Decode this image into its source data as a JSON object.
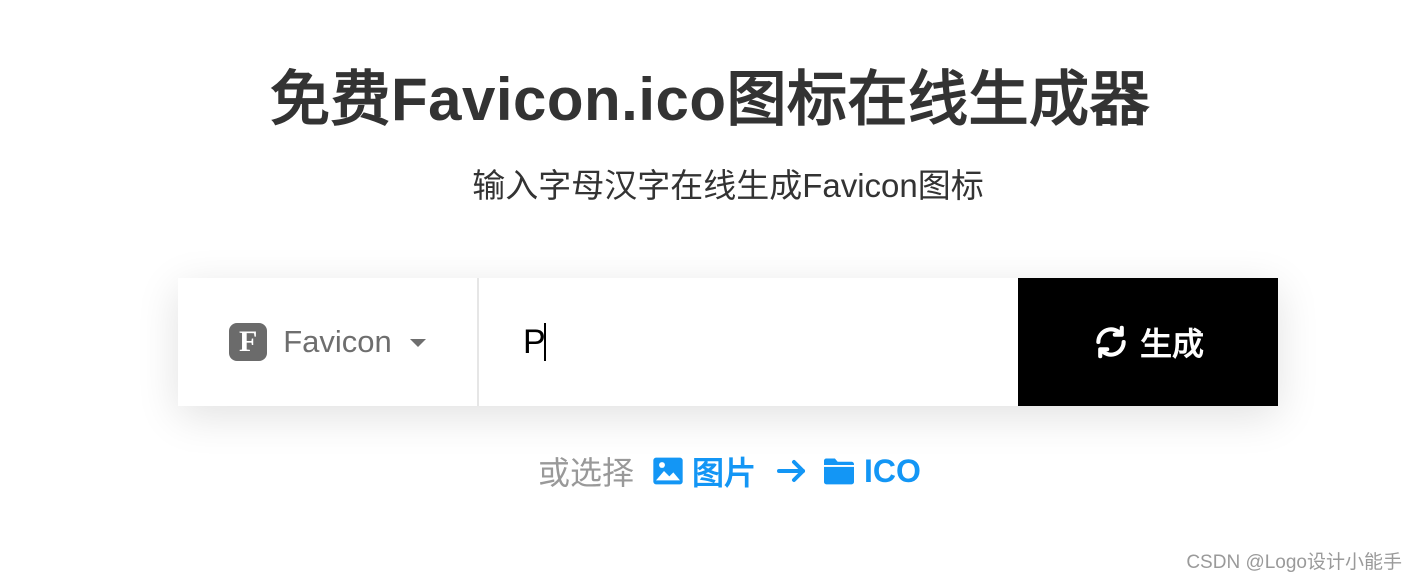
{
  "header": {
    "title": "免费Favicon.ico图标在线生成器",
    "subtitle": "输入字母汉字在线生成Favicon图标"
  },
  "generator": {
    "type_selector": {
      "badge_letter": "F",
      "label": "Favicon",
      "icon": "chevron-down-icon"
    },
    "text_input": {
      "value": "P"
    },
    "generate_button": {
      "label": "生成",
      "icon": "refresh-icon"
    }
  },
  "alternative": {
    "prefix": "或选择",
    "from_label": "图片",
    "from_icon": "image-icon",
    "arrow_icon": "arrow-right-icon",
    "to_label": "ICO",
    "to_icon": "folder-icon"
  },
  "watermark": "CSDN @Logo设计小能手",
  "colors": {
    "accent": "#1396f5",
    "button_bg": "#000000",
    "badge_bg": "#6b6b6b"
  }
}
